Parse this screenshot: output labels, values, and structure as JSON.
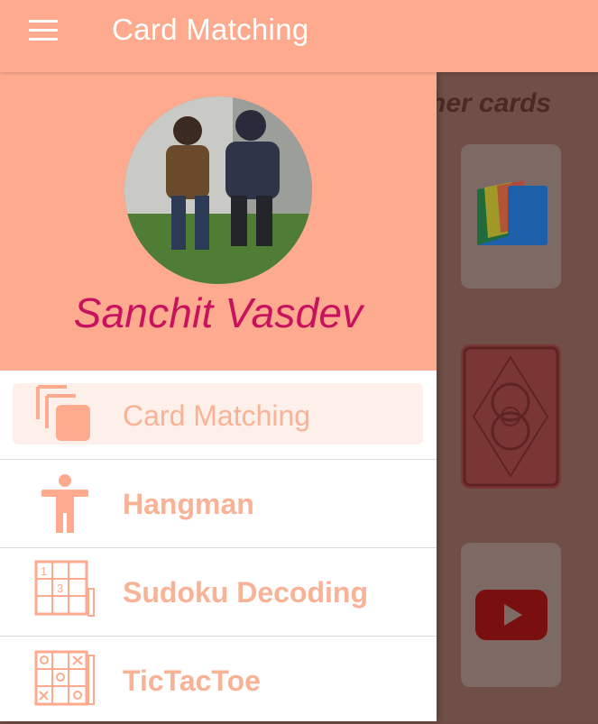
{
  "appbar": {
    "title": "Card Matching",
    "menu_icon": "menu-icon"
  },
  "drawer": {
    "user_name": "Sanchit Vasdev",
    "items": [
      {
        "label": "Card Matching",
        "icon": "cards-stack-icon",
        "active": true
      },
      {
        "label": "Hangman",
        "icon": "person-icon",
        "active": false
      },
      {
        "label": "Sudoku Decoding",
        "icon": "sudoku-grid-icon",
        "active": false
      },
      {
        "label": "TicTacToe",
        "icon": "tictactoe-grid-icon",
        "active": false
      }
    ]
  },
  "background": {
    "hint_text": "her cards",
    "cards": [
      "files-app-icon",
      "playing-card-back",
      "youtube-icon"
    ]
  },
  "colors": {
    "primary": "#fdaa8f",
    "name_color": "#c8125e",
    "nav_text": "#f8b296"
  }
}
